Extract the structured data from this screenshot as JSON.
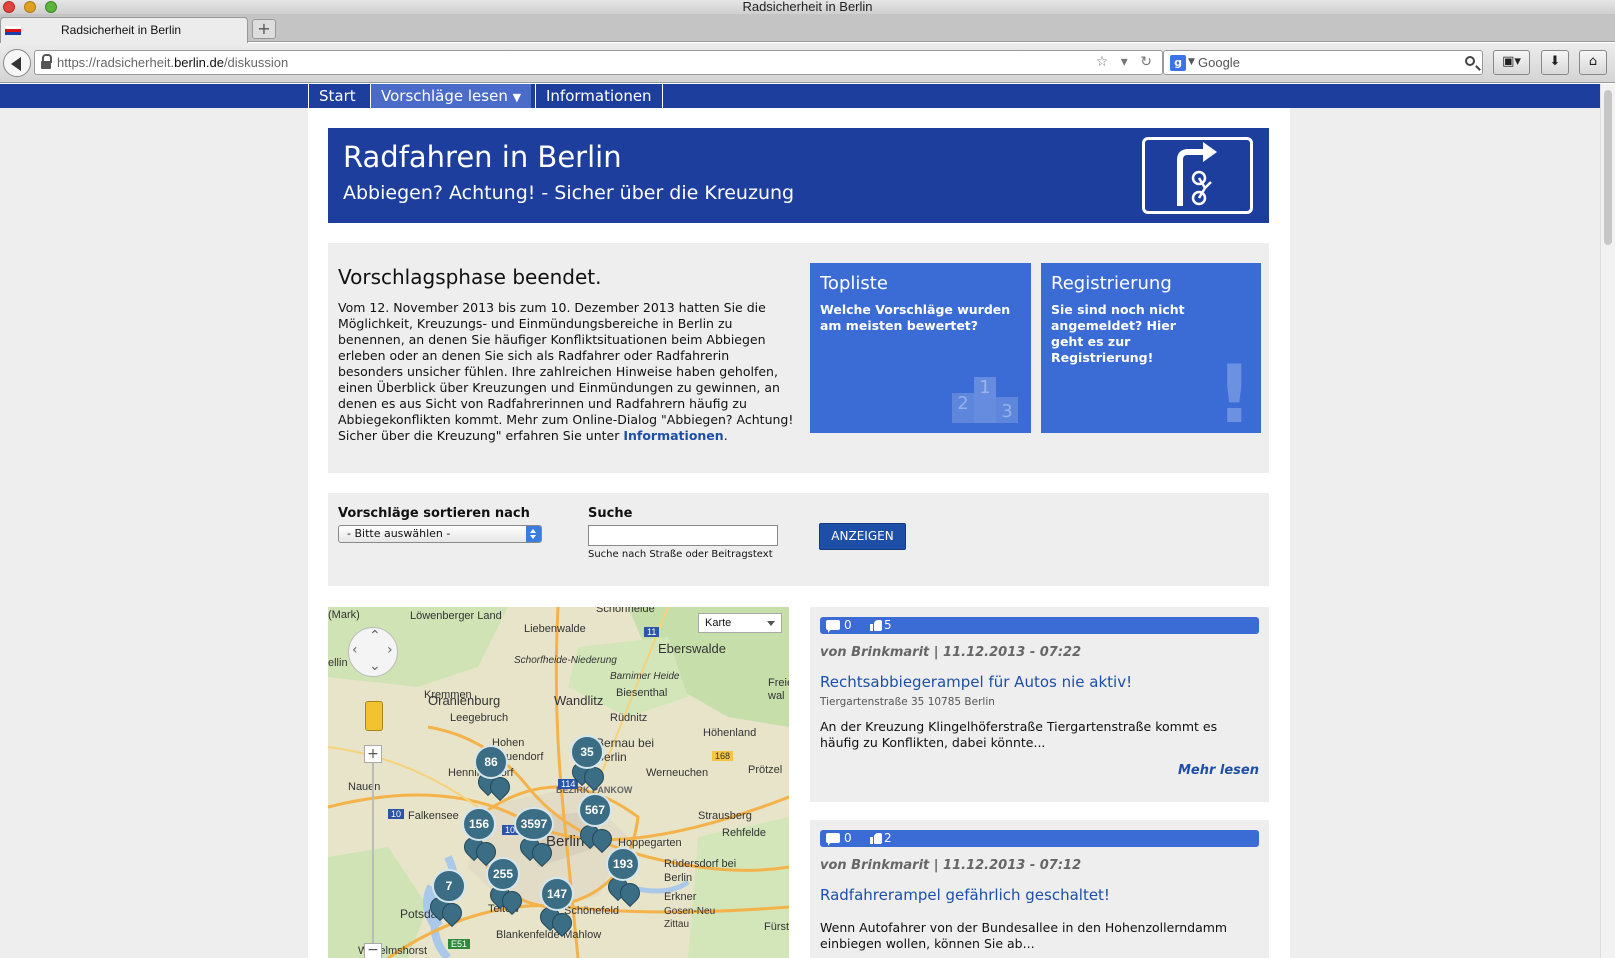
{
  "window": {
    "title": "Radsicherheit in Berlin"
  },
  "tab": {
    "title": "Radsicherheit in Berlin",
    "new_tab": "+"
  },
  "address": {
    "url_prefix": "https://radsicherheit.",
    "url_domain": "berlin.de",
    "url_path": "/diskussion"
  },
  "search": {
    "engine": "Google",
    "engine_letter": "g"
  },
  "site_nav": {
    "items": [
      "Start",
      "Vorschläge lesen",
      "Informationen"
    ],
    "dropdown_arrow": "▼"
  },
  "banner": {
    "title": "Radfahren in Berlin",
    "subtitle": "Abbiegen? Achtung! - Sicher über die Kreuzung"
  },
  "intro": {
    "heading": "Vorschlagsphase beendet.",
    "text": "Vom 12. November 2013 bis zum 10. Dezember 2013 hatten Sie die Möglichkeit, Kreuzungs- und Einmündungsbereiche in Berlin zu benennen, an denen Sie häufiger Konfliktsituationen beim Abbiegen erleben oder an denen Sie sich als Radfahrer oder Radfahrerin besonders unsicher fühlen. Ihre zahlreichen Hinweise haben geholfen, einen Überblick über Kreuzungen und Einmündungen zu gewinnen, an denen es aus Sicht von Radfahrerinnen und Radfahrern häufig zu Abbiegekonflikten kommt. Mehr zum Online-Dialog \"Abbiegen? Achtung! Sicher über die Kreuzung\" erfahren Sie unter ",
    "link": "Informationen",
    "end": "."
  },
  "tiles": {
    "topliste": {
      "title": "Topliste",
      "text": "Welche Vorschläge wurden am meisten bewertet?",
      "podium": [
        "2",
        "1",
        "3"
      ]
    },
    "registrierung": {
      "title": "Registrierung",
      "text": "Sie sind noch nicht angemeldet? Hier geht es zur Registrierung!",
      "mark": "!"
    }
  },
  "filter": {
    "sort_label": "Vorschläge sortieren nach",
    "sort_value": "- Bitte auswählen -",
    "search_label": "Suche",
    "search_value": "",
    "search_hint": "Suche nach Straße oder Beitragstext",
    "button": "ANZEIGEN"
  },
  "map": {
    "type_select": "Karte",
    "zoom_in": "+",
    "zoom_out": "−",
    "places": [
      "Schorfheide",
      "Löwenberger Land",
      "Liebenwalde",
      "Eberswalde",
      "Schorfheide-Niederung",
      "Barnimer Heide",
      "Kremmen",
      "Oranienburg",
      "Wandlitz",
      "Biesenthal",
      "Leegebruch",
      "Rüdnitz",
      "Hohen Neuendorf",
      "Bernau bei Berlin",
      "Werneuchen",
      "Höhenland",
      "Henningsdorf",
      "Prötzel",
      "Nauen",
      "BEZIRK PANKOW",
      "Falkensee",
      "Strausberg",
      "Rehfelde",
      "Berlin",
      "Hoppegarten",
      "Rüdersdorf bei Berlin",
      "Potsdam",
      "Erkner",
      "Gosen-Neu Zittau",
      "Schönefeld",
      "Blankenfelde-Mahlow",
      "Wilhelmshorst",
      "Teltow",
      "ellin",
      "(Mark)",
      "Freien-wal",
      "Fürste"
    ],
    "road_numbers": [
      "11",
      "114",
      "168",
      "10",
      "100",
      "E51"
    ],
    "clusters": [
      "86",
      "35",
      "567",
      "156",
      "3597",
      "255",
      "193",
      "7",
      "147"
    ]
  },
  "posts": [
    {
      "comments": "0",
      "likes": "5",
      "meta": "von Brinkmarit | 11.12.2013 - 07:22",
      "title": "Rechtsabbiegerampel für Autos nie aktiv!",
      "address": "Tiergartenstraße 35 10785 Berlin",
      "text": "An der Kreuzung Klingelhöferstraße Tiergartenstraße kommt es häufig zu Konflikten, dabei könnte...",
      "more": "Mehr lesen"
    },
    {
      "comments": "0",
      "likes": "2",
      "meta": "von Brinkmarit | 11.12.2013 - 07:12",
      "title": "Radfahrerampel gefährlich geschaltet!",
      "text": "Wenn Autofahrer von der Bundesallee in den Hohenzollerndamm einbiegen wollen, können Sie ab..."
    }
  ]
}
